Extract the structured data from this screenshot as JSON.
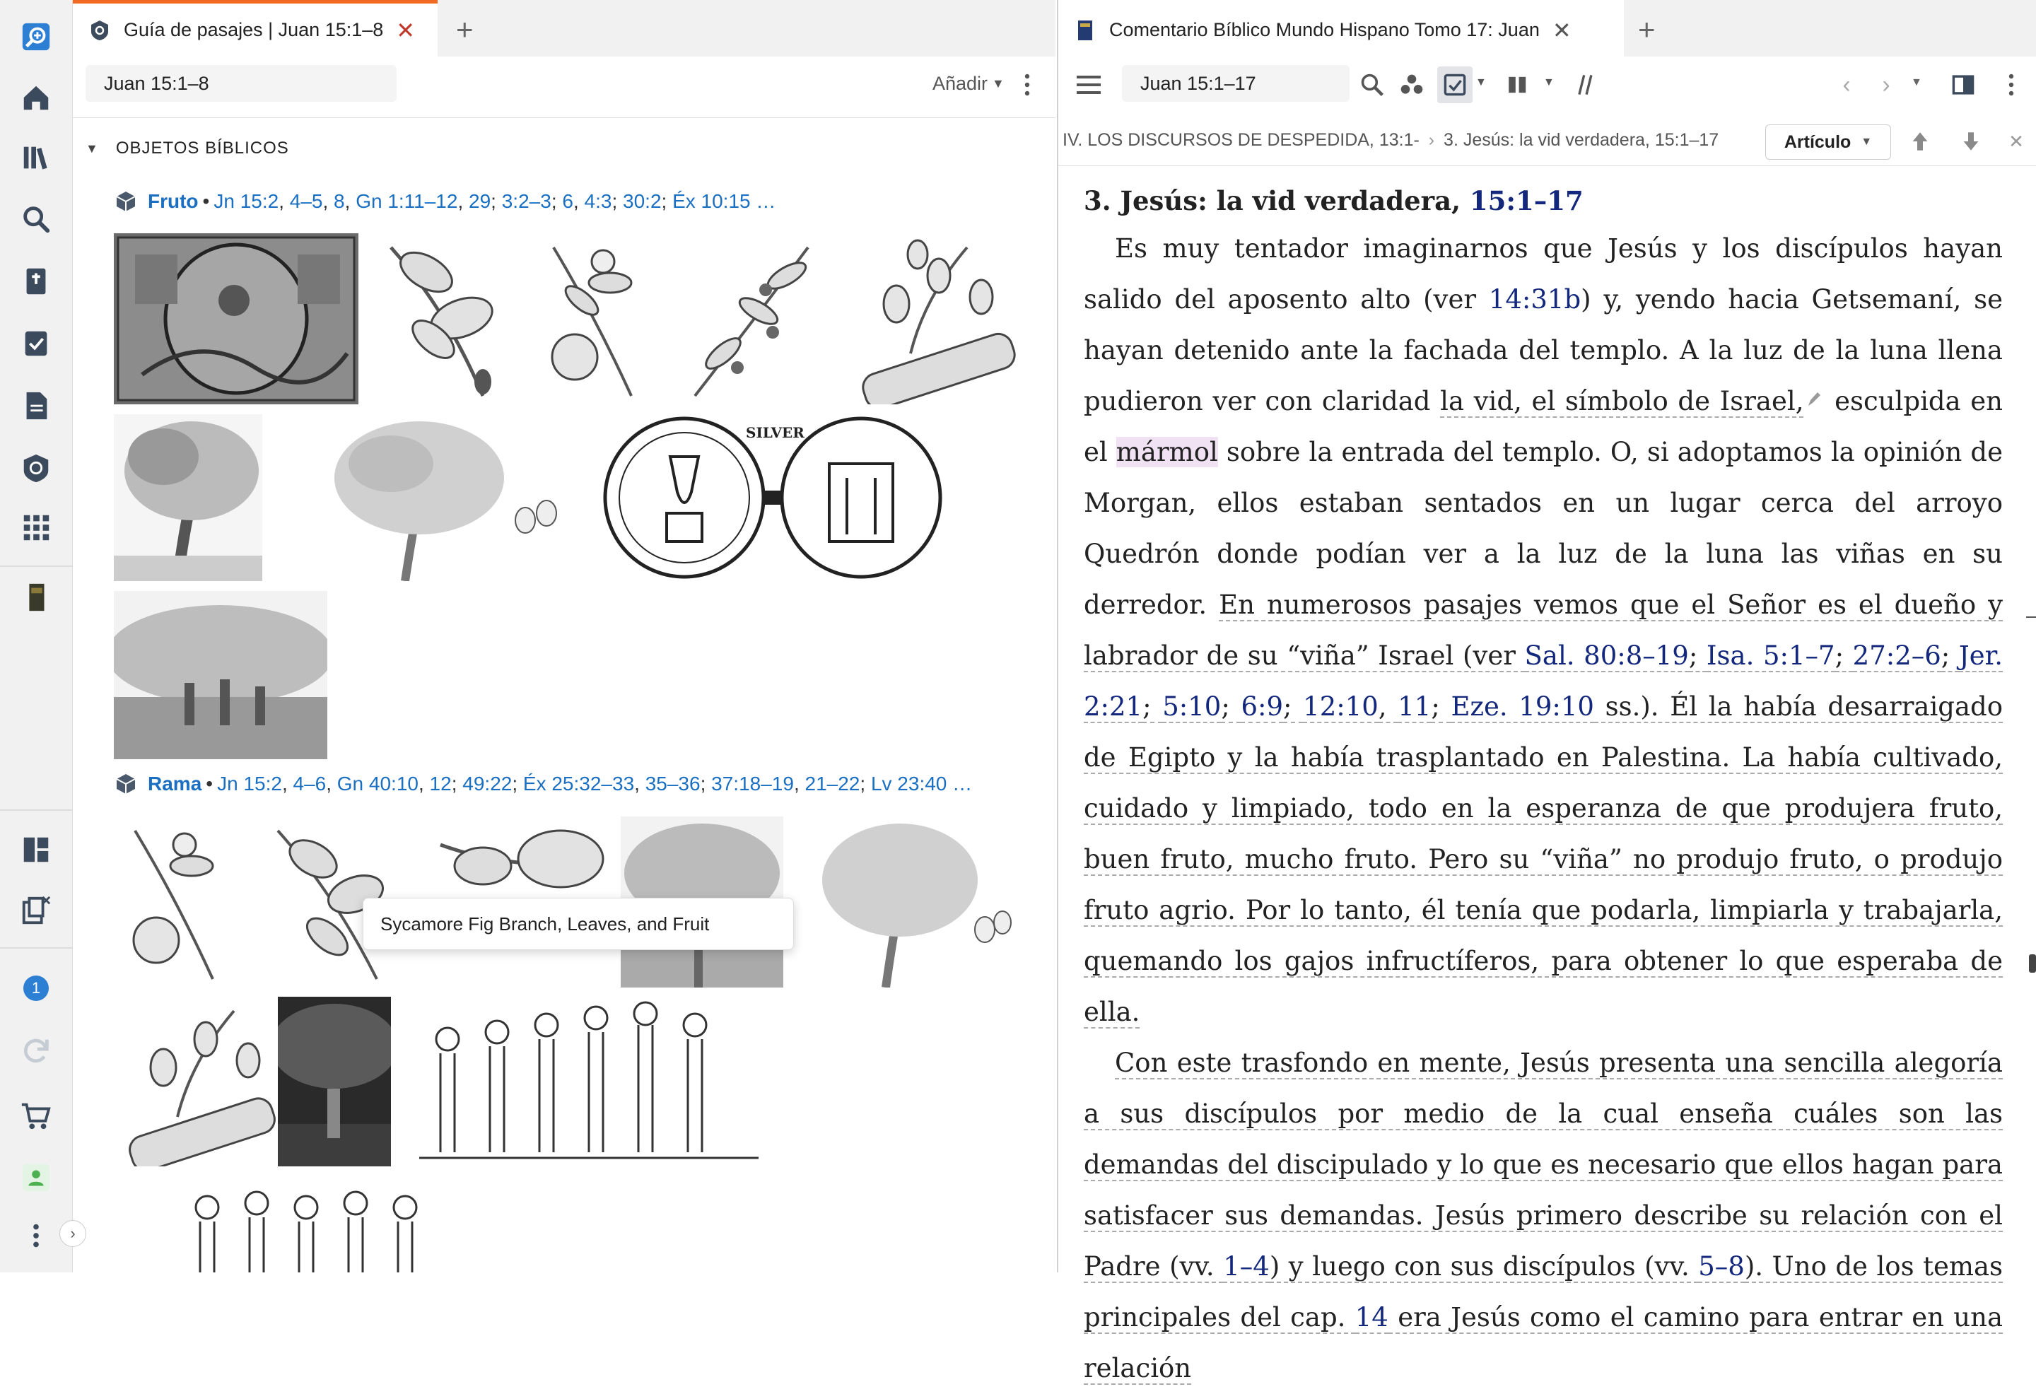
{
  "left_panel": {
    "tab_title": "Guía de pasajes | Juan 15:1–8",
    "reference": "Juan 15:1–8",
    "add_label": "Añadir",
    "section_title": "OBJETOS BÍBLICOS",
    "groups": [
      {
        "name": "Fruto",
        "refs": [
          "Jn 15:2",
          "4–5",
          "8",
          "Gn 1:11–12",
          "29",
          "3:2–3",
          "6",
          "4:3",
          "30:2",
          "Éx 10:15 …"
        ],
        "seps": [
          ", ",
          ", ",
          ", ",
          ", ",
          "; ",
          "; ",
          ", ",
          "; ",
          "; ",
          ""
        ]
      },
      {
        "name": "Rama",
        "refs": [
          "Jn 15:2",
          "4–6",
          "Gn 40:10",
          "12",
          "49:22",
          "Éx 25:32–33",
          "35–36",
          "37:18–19",
          "21–22",
          "Lv 23:40 …"
        ],
        "seps": [
          ", ",
          ", ",
          ", ",
          "; ",
          "; ",
          ", ",
          "; ",
          ", ",
          "; ",
          ""
        ]
      }
    ],
    "tooltip": "Sycamore Fig Branch, Leaves, and Fruit",
    "coin_text": "SILVER"
  },
  "right_panel": {
    "tab_title": "Comentario Bíblico Mundo Hispano Tomo 17: Juan",
    "reference": "Juan 15:1–17",
    "breadcrumb_1": "IV. LOS DISCURSOS DE DESPEDIDA, 13:1-",
    "breadcrumb_2": "3. Jesús: la vid verdadera, 15:1–17",
    "article_button": "Artículo",
    "heading": "3. Jesús: la vid verdadera,",
    "heading_ref": "15:1–17",
    "p1": [
      "Es muy tentador imaginarnos que Jesús y los discípulos hayan salido del aposento alto (ver ",
      "14:31b",
      ") y, yendo hacia Getsemaní, se hayan detenido ante la fachada del templo. A la luz de la luna llena pudieron ver con claridad ",
      "la vid, el símbolo de Israel,",
      " esculpida en el ",
      "mármol",
      " sobre la entrada del templo. O, si adoptamos la opinión de Morgan, ellos estaban sentados en un lugar cerca del arroyo Quedrón donde podían ver a la luz de la luna las viñas en su derredor. ",
      "En numerosos pasajes vemos que el Señor es el dueño y labrador de su “viña” Israel (ver ",
      "Sal. 80:8–19",
      "; ",
      "Isa. 5:1–7",
      "; ",
      "27:2–6",
      "; ",
      "Jer. 2:21",
      "; ",
      "5:10",
      "; ",
      "6:9",
      "; ",
      "12:10",
      ", ",
      "11",
      "; ",
      "Eze. 19:10",
      " ss.). Él la había desarraigado de Egipto y la había trasplantado en Palestina. La había cultivado, cuidado y limpiado, todo en la esperanza de que produjera fruto, buen fruto, mucho fruto. Pero su “viña” no produjo fruto, o produjo fruto agrio. Por lo tanto, él tenía que podarla, limpiarla y trabajarla, quemando los gajos infructíferos, para obtener lo que esperaba de ella."
    ],
    "p2": [
      "Con este trasfondo en mente, Jesús presenta una sencilla alegoría a sus discípulos por medio de la cual enseña cuáles son las demandas del discipulado y lo que es necesario que ellos hagan para satisfacer sus demandas. Jesús primero describe su relación con el Padre (vv. ",
      "1–4",
      ") y luego con sus discípulos (vv. ",
      "5–8",
      "). Uno de los temas principales del cap. ",
      "14",
      " era Jesús como el camino para entrar en una relación"
    ]
  },
  "sidebar": {
    "notification_count": "1"
  }
}
